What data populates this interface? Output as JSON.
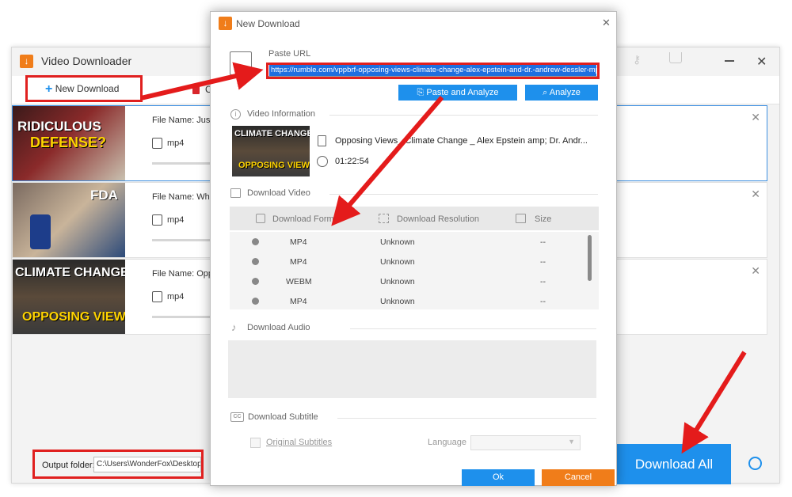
{
  "app": {
    "title": "Video Downloader",
    "new_download": "New Download",
    "clear_fragment": "C"
  },
  "items": [
    {
      "file_name": "File Name: Jussie",
      "format": "mp4",
      "thumb_line1": "RIDICULOUS",
      "thumb_line2": "DEFENSE?"
    },
    {
      "file_name": "File Name: What",
      "format": "mp4",
      "thumb_line1": "FDA"
    },
    {
      "file_name": "File Name: Oppo",
      "format": "mp4",
      "thumb_line1": "CLIMATE CHANGE",
      "thumb_line2": "OPPOSING VIEWS"
    }
  ],
  "bottom": {
    "output_label": "Output folder:",
    "output_path": "C:\\Users\\WonderFox\\Desktop",
    "download_all": "Download All"
  },
  "dialog": {
    "title": "New Download",
    "paste_url_label": "Paste URL",
    "url": "https://rumble.com/vppbrf-opposing-views-climate-change-alex-epstein-and-dr.-andrew-dessler-mp-p",
    "paste_analyze": "Paste and Analyze",
    "analyze": "Analyze",
    "video_info_label": "Video Information",
    "video_title": "Opposing Views_ Climate Change _ Alex Epstein amp; Dr. Andr...",
    "duration": "01:22:54",
    "thumb_line1": "CLIMATE CHANGE",
    "thumb_line2": "OPPOSING VIEWS",
    "download_video_label": "Download Video",
    "col_format": "Download Format",
    "col_resolution": "Download Resolution",
    "col_size": "Size",
    "rows": [
      {
        "format": "MP4",
        "resolution": "Unknown",
        "size": "--"
      },
      {
        "format": "MP4",
        "resolution": "Unknown",
        "size": "--"
      },
      {
        "format": "WEBM",
        "resolution": "Unknown",
        "size": "--"
      },
      {
        "format": "MP4",
        "resolution": "Unknown",
        "size": "--"
      }
    ],
    "download_audio_label": "Download Audio",
    "download_subtitle_label": "Download Subtitle",
    "original_subtitles": "Original Subtitles",
    "language_label": "Language",
    "ok": "Ok",
    "cancel": "Cancel"
  },
  "colors": {
    "accent": "#1e90ec",
    "cancel": "#f07d1a",
    "annotation": "#e41b1b"
  }
}
